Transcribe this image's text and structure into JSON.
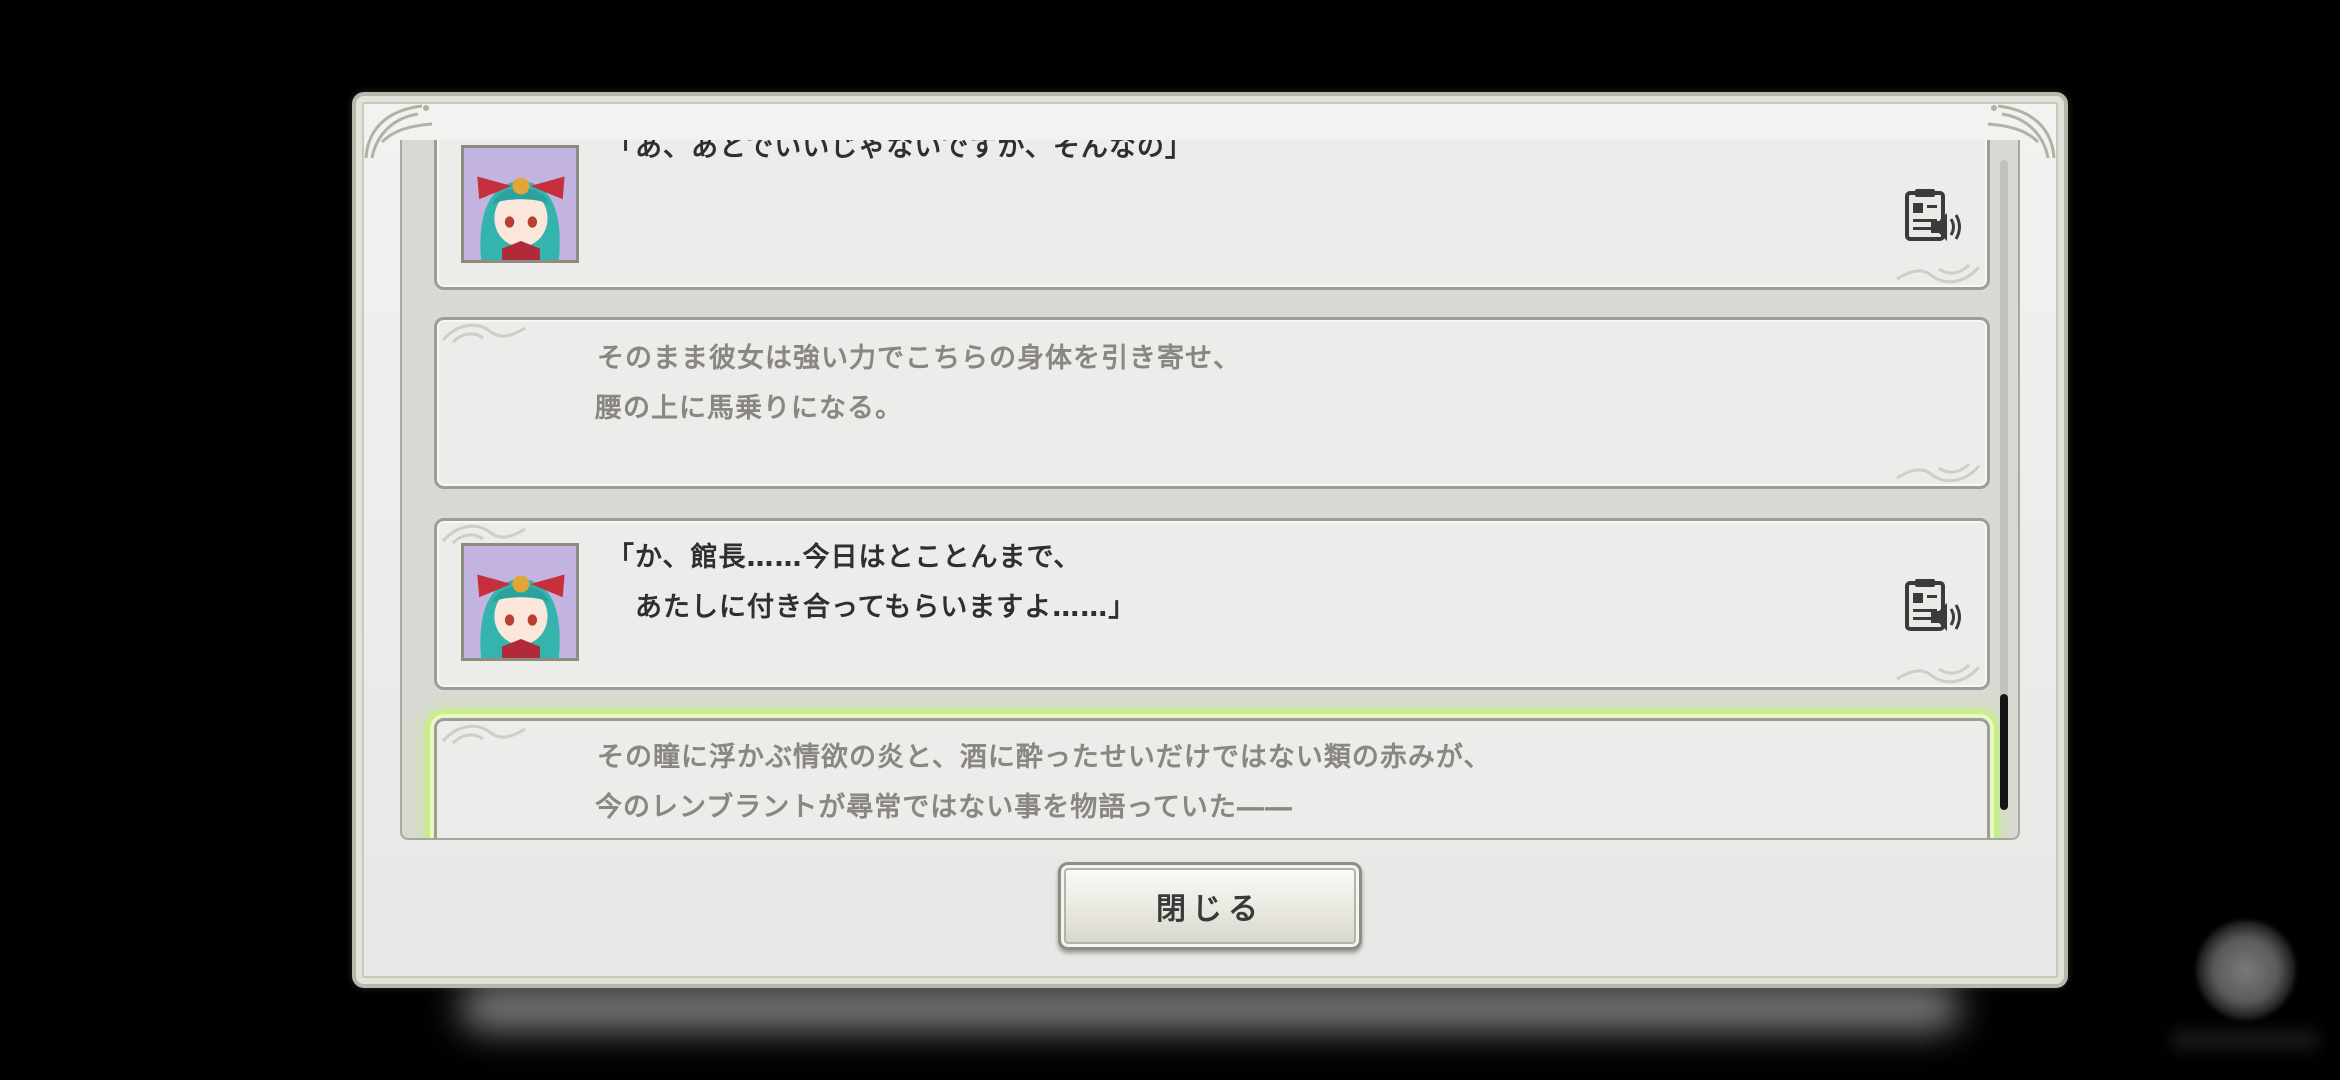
{
  "backlog": {
    "entries": [
      {
        "type": "speech",
        "lines": [
          "「あ、あとでいいじゃないですか、そんなの」"
        ],
        "has_voice": true
      },
      {
        "type": "narration",
        "lines": [
          "そのまま彼女は強い力でこちらの身体を引き寄せ、",
          "腰の上に馬乗りになる。"
        ]
      },
      {
        "type": "speech",
        "lines": [
          "「か、館長……今日はとことんまで、",
          "　あたしに付き合ってもらいますよ……」"
        ],
        "has_voice": true
      },
      {
        "type": "narration",
        "lines": [
          "その瞳に浮かぶ情欲の炎と、酒に酔ったせいだけではない類の赤みが、",
          "今のレンブラントが尋常ではない事を物語っていた――"
        ],
        "highlighted": true
      }
    ],
    "close_label": "閉じる"
  },
  "icons": {
    "voice": "voice-replay-icon",
    "portrait": "character-portrait",
    "overlay": "floating-assistive-ball"
  },
  "colors": {
    "highlight": "#c8ef82",
    "panel": "#ececea",
    "speech_text": "#2f2f2f",
    "narration_text": "#8a8680"
  }
}
